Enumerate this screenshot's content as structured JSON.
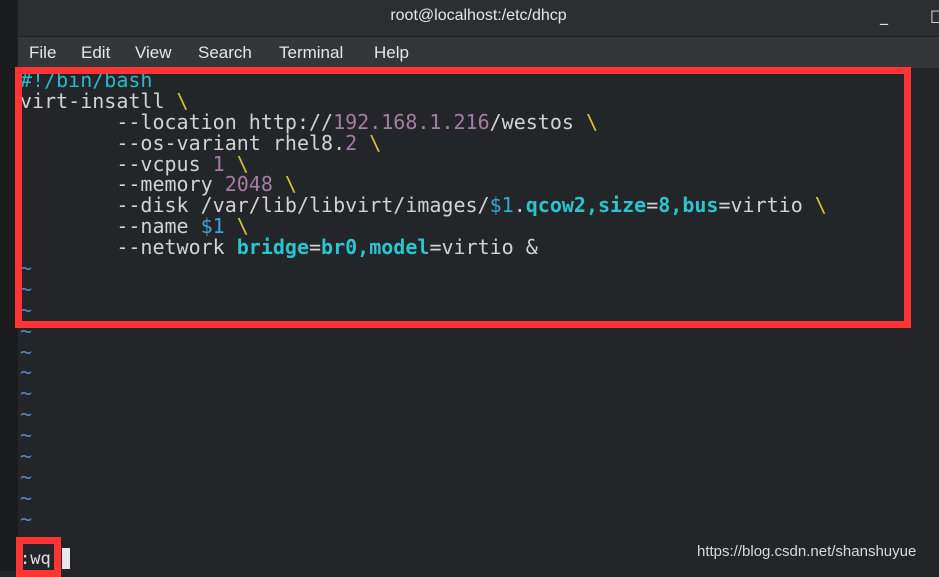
{
  "window": {
    "title": "root@localhost:/etc/dhcp",
    "minimize_label": "_",
    "maximize_label": "□"
  },
  "menu": [
    "File",
    "Edit",
    "View",
    "Search",
    "Terminal",
    "Help"
  ],
  "colors": {
    "highlight_box": "#ff3535",
    "background": "#232629",
    "keyword": "#2bc4cf",
    "number": "#a67ca6",
    "backslash": "#d5c23a"
  },
  "editor": {
    "lines": [
      [
        {
          "t": "#!/bin/bash",
          "c": "cyan"
        }
      ],
      [
        {
          "t": "virt-insatll ",
          "c": "text"
        },
        {
          "t": "\\",
          "c": "yellow"
        }
      ],
      [
        {
          "t": "        --location http://",
          "c": "text"
        },
        {
          "t": "192.168.1.216",
          "c": "purple"
        },
        {
          "t": "/westos ",
          "c": "text"
        },
        {
          "t": "\\",
          "c": "yellow"
        }
      ],
      [
        {
          "t": "        --os-variant rhel8.",
          "c": "text"
        },
        {
          "t": "2",
          "c": "purple"
        },
        {
          "t": " ",
          "c": "text"
        },
        {
          "t": "\\",
          "c": "yellow"
        }
      ],
      [
        {
          "t": "        --vcpus ",
          "c": "text"
        },
        {
          "t": "1",
          "c": "purple"
        },
        {
          "t": " ",
          "c": "text"
        },
        {
          "t": "\\",
          "c": "yellow"
        }
      ],
      [
        {
          "t": "        --memory ",
          "c": "text"
        },
        {
          "t": "2048",
          "c": "purple"
        },
        {
          "t": " ",
          "c": "text"
        },
        {
          "t": "\\",
          "c": "yellow"
        }
      ],
      [
        {
          "t": "        --disk /var/lib/libvirt/images/",
          "c": "text"
        },
        {
          "t": "$1",
          "c": "var"
        },
        {
          "t": ".",
          "c": "text"
        },
        {
          "t": "qcow2",
          "c": "cyanb"
        },
        {
          "t": ",",
          "c": "cyanb"
        },
        {
          "t": "size",
          "c": "cyanb"
        },
        {
          "t": "=",
          "c": "text"
        },
        {
          "t": "8",
          "c": "cyanb"
        },
        {
          "t": ",",
          "c": "cyanb"
        },
        {
          "t": "bus",
          "c": "cyanb"
        },
        {
          "t": "=virtio ",
          "c": "text"
        },
        {
          "t": "\\",
          "c": "yellow"
        }
      ],
      [
        {
          "t": "        --name ",
          "c": "text"
        },
        {
          "t": "$1",
          "c": "var"
        },
        {
          "t": " ",
          "c": "text"
        },
        {
          "t": "\\",
          "c": "yellow"
        }
      ],
      [
        {
          "t": "        --network ",
          "c": "text"
        },
        {
          "t": "bridge",
          "c": "cyanb"
        },
        {
          "t": "=",
          "c": "text"
        },
        {
          "t": "br0",
          "c": "cyanb"
        },
        {
          "t": ",",
          "c": "cyanb"
        },
        {
          "t": "model",
          "c": "cyanb"
        },
        {
          "t": "=virtio &",
          "c": "text"
        }
      ]
    ],
    "tilde": "~",
    "tilde_count": 13,
    "command_line": ":wq"
  },
  "watermark": "https://blog.csdn.net/shanshuyue"
}
